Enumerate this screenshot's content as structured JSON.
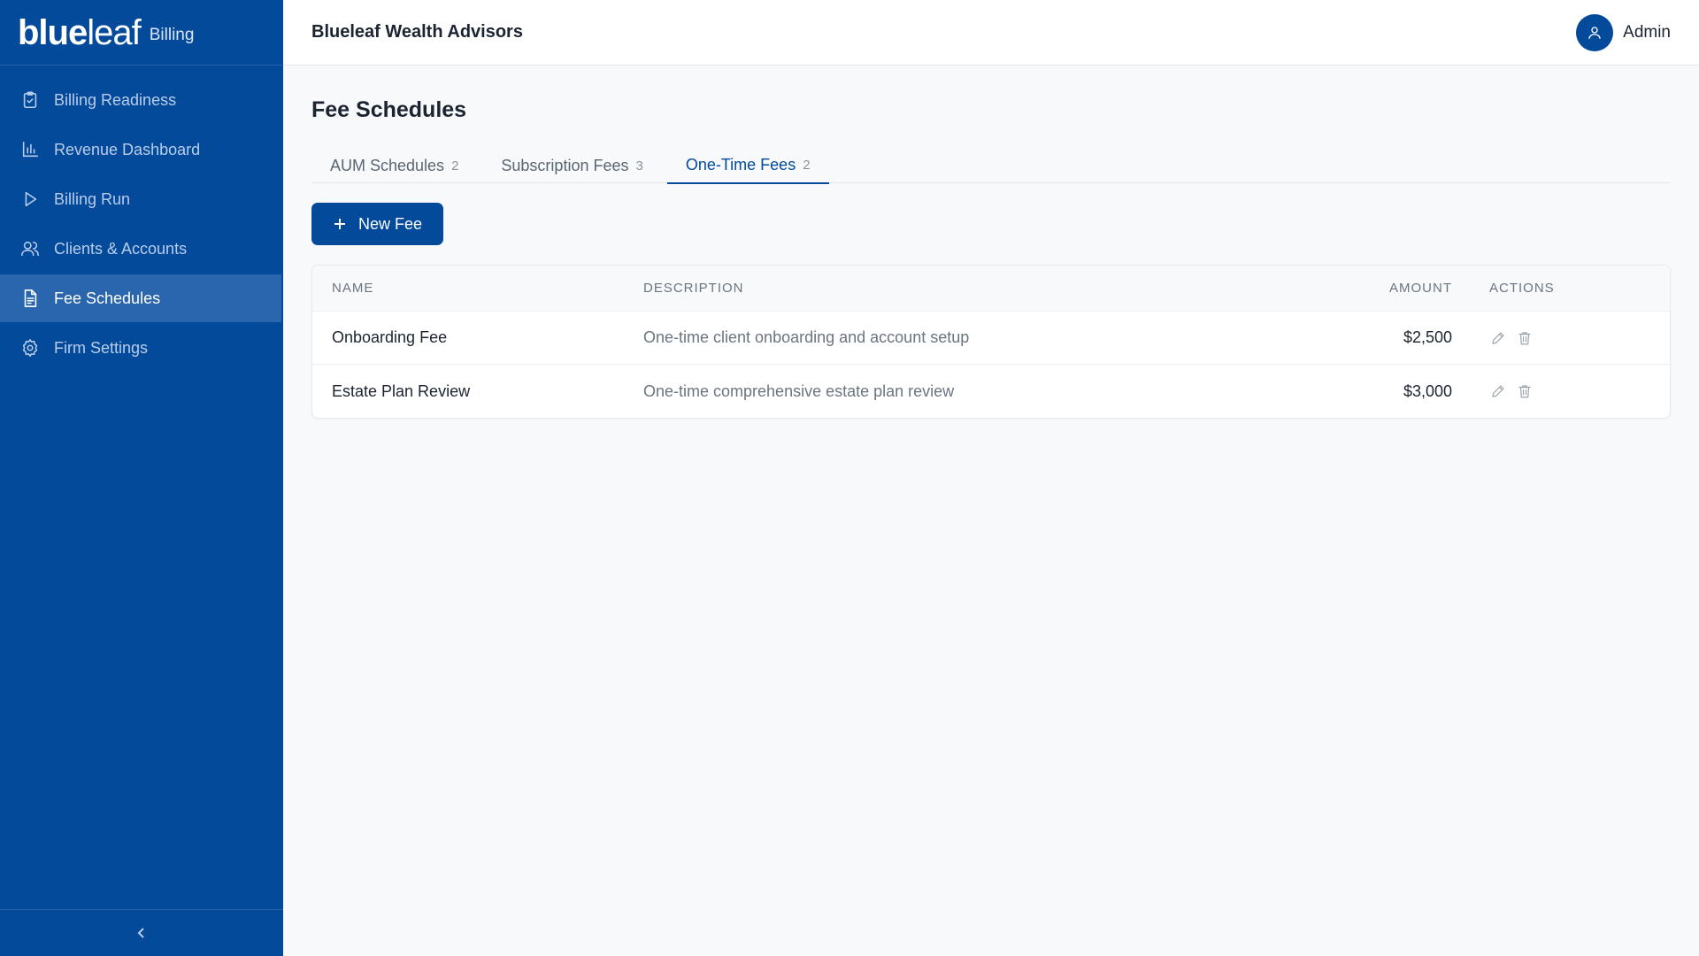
{
  "brand": {
    "logo_bold": "blue",
    "logo_light": "leaf",
    "sub": "Billing"
  },
  "sidebar": {
    "items": [
      {
        "label": "Billing Readiness",
        "icon": "clipboard-check-icon"
      },
      {
        "label": "Revenue Dashboard",
        "icon": "bar-chart-icon"
      },
      {
        "label": "Billing Run",
        "icon": "play-icon"
      },
      {
        "label": "Clients & Accounts",
        "icon": "users-icon"
      },
      {
        "label": "Fee Schedules",
        "icon": "document-icon",
        "active": true
      },
      {
        "label": "Firm Settings",
        "icon": "gear-icon"
      }
    ],
    "collapse_icon": "chevron-left-icon"
  },
  "header": {
    "firm": "Blueleaf Wealth Advisors",
    "user": "Admin"
  },
  "page": {
    "title": "Fee Schedules",
    "tabs": [
      {
        "label": "AUM Schedules",
        "count": "2"
      },
      {
        "label": "Subscription Fees",
        "count": "3"
      },
      {
        "label": "One-Time Fees",
        "count": "2",
        "active": true
      }
    ],
    "new_button": "New Fee"
  },
  "table": {
    "columns": {
      "name": "NAME",
      "description": "DESCRIPTION",
      "amount": "AMOUNT",
      "actions": "ACTIONS"
    },
    "rows": [
      {
        "name": "Onboarding Fee",
        "description": "One-time client onboarding and account setup",
        "amount": "$2,500"
      },
      {
        "name": "Estate Plan Review",
        "description": "One-time comprehensive estate plan review",
        "amount": "$3,000"
      }
    ]
  },
  "colors": {
    "primary": "#044a9b",
    "sidebar_active": "#2a66ad",
    "background": "#f7f9fb"
  }
}
